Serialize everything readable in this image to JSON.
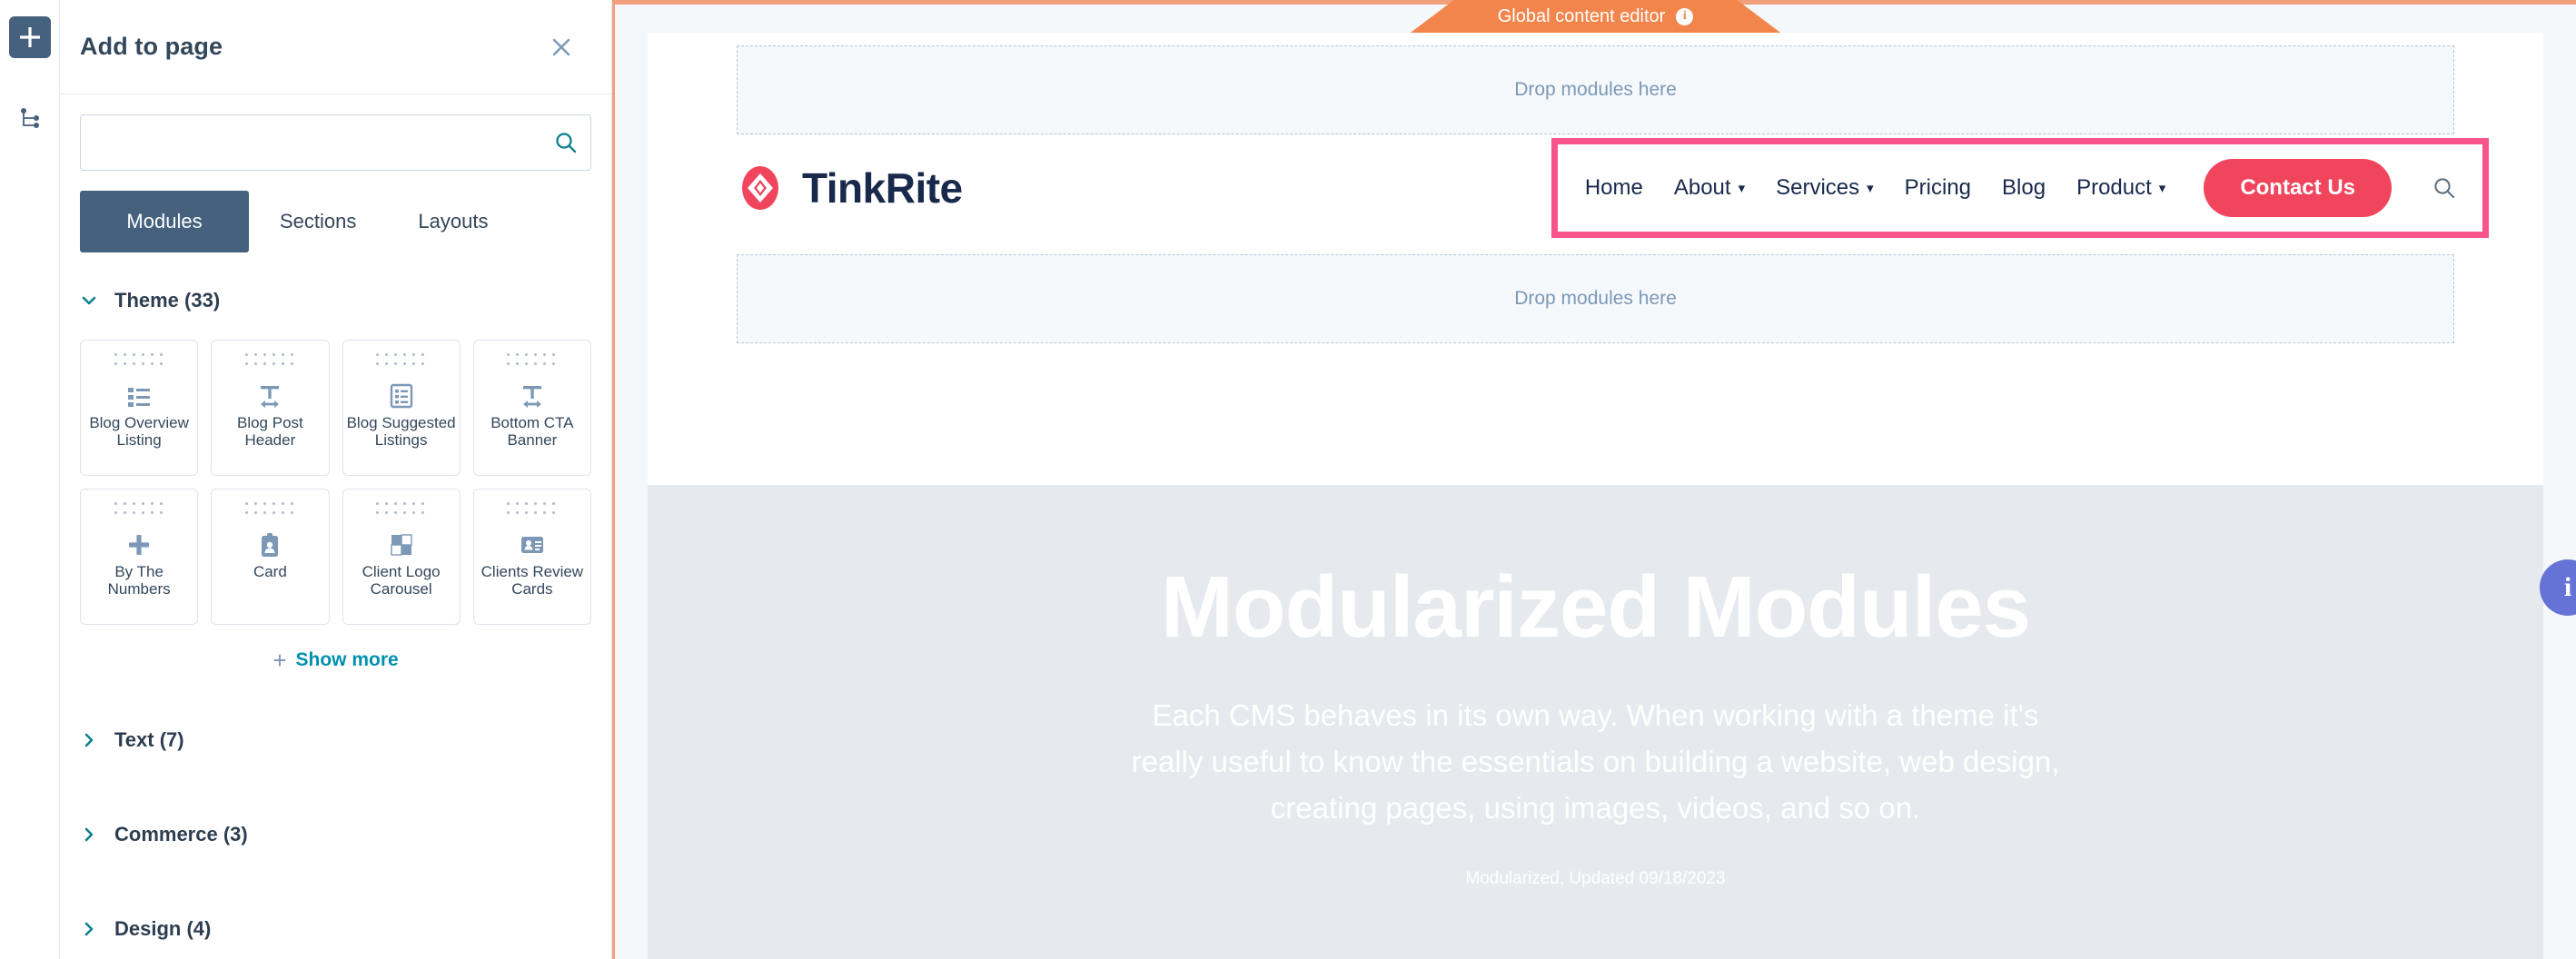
{
  "rail": {
    "add_icon": "plus-icon",
    "tree_icon": "sitemap-icon"
  },
  "panel": {
    "title": "Add to page",
    "close_icon": "close-icon",
    "search": {
      "value": "",
      "placeholder": "",
      "icon": "search-icon"
    },
    "tabs": [
      {
        "label": "Modules",
        "active": true
      },
      {
        "label": "Sections",
        "active": false
      },
      {
        "label": "Layouts",
        "active": false
      }
    ],
    "groups": [
      {
        "label": "Theme (33)",
        "expanded": true
      },
      {
        "label": "Text (7)",
        "expanded": false
      },
      {
        "label": "Commerce (3)",
        "expanded": false
      },
      {
        "label": "Design (4)",
        "expanded": false
      }
    ],
    "modules": [
      {
        "label": "Blog Overview Listing",
        "icon": "list-icon"
      },
      {
        "label": "Blog Post Header",
        "icon": "text-width-icon"
      },
      {
        "label": "Blog Suggested Listings",
        "icon": "document-list-icon"
      },
      {
        "label": "Bottom CTA Banner",
        "icon": "text-width-icon"
      },
      {
        "label": "By The Numbers",
        "icon": "plus-icon"
      },
      {
        "label": "Card",
        "icon": "id-card-icon"
      },
      {
        "label": "Client Logo Carousel",
        "icon": "grid-squares-icon"
      },
      {
        "label": "Clients Review Cards",
        "icon": "contact-card-icon"
      }
    ],
    "show_more": "Show more"
  },
  "editor": {
    "banner": {
      "text": "Global content editor",
      "info_icon": "info-icon",
      "color": "#f2854c"
    },
    "dropzone_top": "Drop modules here",
    "dropzone_bottom": "Drop modules here",
    "selection_color": "#f8548b"
  },
  "site": {
    "brand": {
      "name": "TinkRite",
      "logo_icon": "diamond-logo-icon",
      "logo_color": "#f0455c"
    },
    "nav": [
      {
        "label": "Home",
        "has_dropdown": false
      },
      {
        "label": "About",
        "has_dropdown": true
      },
      {
        "label": "Services",
        "has_dropdown": true
      },
      {
        "label": "Pricing",
        "has_dropdown": false
      },
      {
        "label": "Blog",
        "has_dropdown": false
      },
      {
        "label": "Product",
        "has_dropdown": true
      }
    ],
    "cta": {
      "label": "Contact Us",
      "color": "#f0455c"
    },
    "nav_search_icon": "search-icon",
    "hero": {
      "heading": "Modularized Modules",
      "body": "Each CMS behaves in its own way. When working with a theme it's really useful to know the essentials on building a website, web design, creating pages, using images, videos, and so on.",
      "stamp": "Modularized, Updated 09/18/2023"
    }
  },
  "chat": {
    "label": "i"
  }
}
